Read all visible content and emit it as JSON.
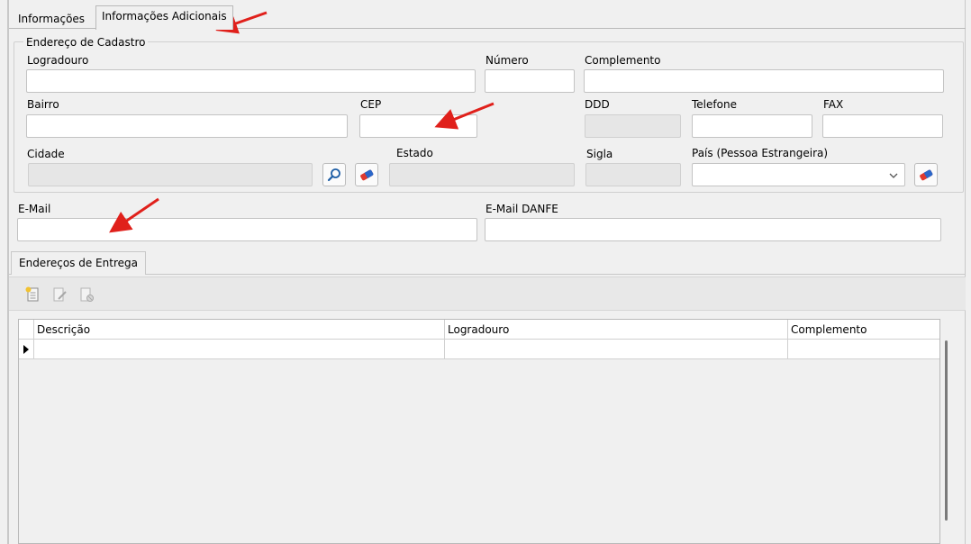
{
  "tabs": [
    {
      "label": "Informações"
    },
    {
      "label": "Informações Adicionais"
    }
  ],
  "address_group": {
    "title": "Endereço de Cadastro",
    "labels": {
      "logradouro": "Logradouro",
      "numero": "Número",
      "complemento": "Complemento",
      "bairro": "Bairro",
      "cep": "CEP",
      "ddd": "DDD",
      "telefone": "Telefone",
      "fax": "FAX",
      "cidade": "Cidade",
      "estado": "Estado",
      "sigla": "Sigla",
      "pais": "País (Pessoa Estrangeira)"
    },
    "values": {
      "logradouro": "",
      "numero": "",
      "complemento": "",
      "bairro": "",
      "cep": "",
      "ddd": "",
      "telefone": "",
      "fax": "",
      "cidade": "",
      "estado": "",
      "sigla": "",
      "pais": ""
    }
  },
  "email": {
    "label": "E-Mail",
    "value": "",
    "danfe_label": "E-Mail DANFE",
    "danfe_value": ""
  },
  "delivery": {
    "tab_label": "Endereços de Entrega",
    "toolbar": [
      "add-record-icon",
      "edit-record-icon",
      "delete-record-icon"
    ],
    "columns": [
      "Descrição",
      "Logradouro",
      "Complemento"
    ],
    "rows": [
      [
        "",
        "",
        ""
      ]
    ]
  },
  "colors": {
    "annotation_arrow": "#e0201b",
    "field_border": "#c3c3c3",
    "disabled_field": "#e6e6e6",
    "search_icon": "#1f5fa6",
    "eraser_icon": "#2a67c9"
  }
}
